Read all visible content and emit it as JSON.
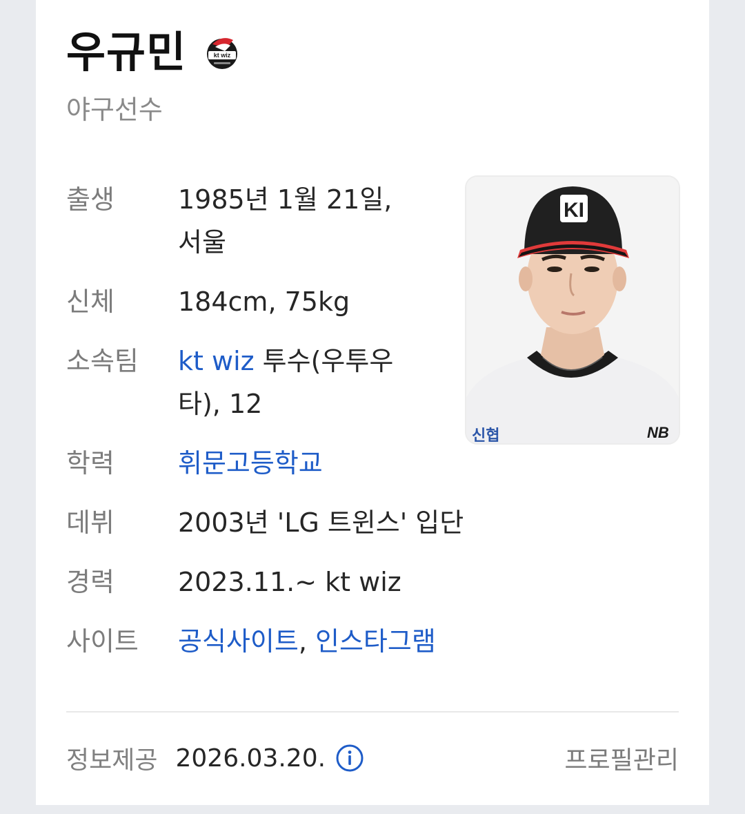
{
  "profile": {
    "name": "우규민",
    "team_logo_icon": "kt-wiz-logo",
    "subtitle": "야구선수"
  },
  "info": {
    "birth": {
      "label": "출생",
      "line1": "1985년 1월 21일,",
      "line2": "서울"
    },
    "body": {
      "label": "신체",
      "value": "184cm, 75kg"
    },
    "team": {
      "label": "소속팀",
      "link": "kt wiz",
      "line1_rest": " 투수(우투우",
      "line2": "타), 12"
    },
    "education": {
      "label": "학력",
      "link": "휘문고등학교"
    },
    "debut": {
      "label": "데뷔",
      "value": "2003년 'LG 트윈스' 입단"
    },
    "career": {
      "label": "경력",
      "value": "2023.11.~ kt wiz"
    },
    "site": {
      "label": "사이트",
      "link1": "공식사이트",
      "separator": ",",
      "link2": "인스타그램"
    }
  },
  "photo": {
    "cap_letters": "KI",
    "jersey_sponsor": "신협",
    "brand_mark": "NB"
  },
  "footer": {
    "label": "정보제공",
    "date": "2026.03.20.",
    "info_icon": "info-circle-icon",
    "manage_label": "프로필관리"
  },
  "colors": {
    "link": "#1e5cc8",
    "label": "#7c7c7c",
    "value": "#262626",
    "name": "#111111"
  }
}
